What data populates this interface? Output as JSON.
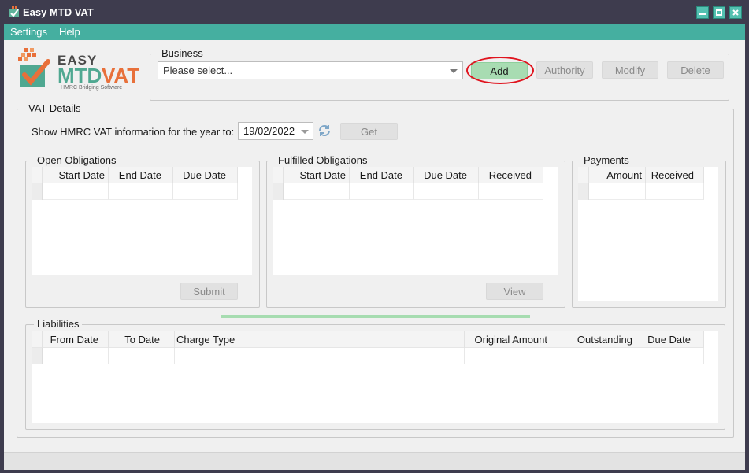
{
  "window": {
    "title": "Easy MTD VAT",
    "controls": [
      "minimize-icon",
      "maximize-icon",
      "close-icon"
    ],
    "colors": {
      "titlebar": "#3e3c4e",
      "menubar": "#45afa0",
      "accent_green": "#a8dcb2",
      "highlight_red": "#e0141e"
    }
  },
  "menu": {
    "items": [
      "Settings",
      "Help"
    ]
  },
  "logo": {
    "line1": "EASY",
    "line2_a": "MTD",
    "line2_b": "VAT",
    "tagline": "HMRC Bridging Software"
  },
  "business": {
    "group_label": "Business",
    "select_value": "Please select...",
    "buttons": {
      "add": "Add",
      "authority": "Authority",
      "modify": "Modify",
      "delete": "Delete"
    }
  },
  "vat_details": {
    "group_label": "VAT Details",
    "year_label": "Show HMRC VAT information for the year to:",
    "date_value": "19/02/2022",
    "get_button": "Get"
  },
  "open_obligations": {
    "group_label": "Open Obligations",
    "columns": [
      "Start Date",
      "End Date",
      "Due Date"
    ],
    "submit_button": "Submit"
  },
  "fulfilled_obligations": {
    "group_label": "Fulfilled Obligations",
    "columns": [
      "Start Date",
      "End Date",
      "Due Date",
      "Received"
    ],
    "view_button": "View"
  },
  "payments": {
    "group_label": "Payments",
    "columns": [
      "Amount",
      "Received"
    ]
  },
  "liabilities": {
    "group_label": "Liabilities",
    "columns": [
      "From Date",
      "To Date",
      "Charge Type",
      "Original Amount",
      "Outstanding",
      "Due Date"
    ]
  }
}
